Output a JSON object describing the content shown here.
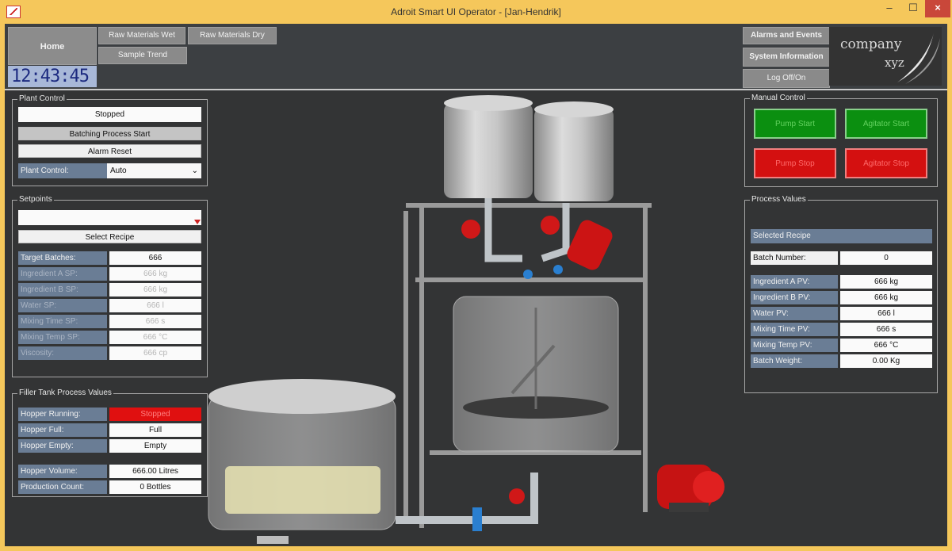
{
  "window": {
    "title": "Adroit Smart UI Operator - [Jan-Hendrik]",
    "minimize": "–",
    "maximize": "☐",
    "close": "×"
  },
  "nav": {
    "home": "Home",
    "raw_materials_wet": "Raw Materials Wet",
    "raw_materials_dry": "Raw Materials Dry",
    "sample_trend": "Sample Trend",
    "alarms_events": "Alarms and Events",
    "system_information": "System Information",
    "log_off": "Log Off/On",
    "clock": "12:43:45"
  },
  "logo": {
    "line1": "company",
    "line2": "xyz"
  },
  "plant_control": {
    "title": "Plant Control",
    "status": "Stopped",
    "batch_start": "Batching Process Start",
    "alarm_reset": "Alarm Reset",
    "mode_label": "Plant Control:",
    "mode_value": "Auto"
  },
  "setpoints": {
    "title": "Setpoints",
    "recipe_input": "",
    "select_recipe": "Select Recipe",
    "rows": [
      {
        "label": "Target Batches:",
        "value": "666"
      },
      {
        "label": "Ingredient A SP:",
        "value": "666 kg"
      },
      {
        "label": "Ingredient B SP:",
        "value": "666 kg"
      },
      {
        "label": "Water SP:",
        "value": "666 l"
      },
      {
        "label": "Mixing Time SP:",
        "value": "666 s"
      },
      {
        "label": "Mixing Temp SP:",
        "value": "666 °C"
      },
      {
        "label": "Viscosity:",
        "value": "666 cp"
      }
    ]
  },
  "filler": {
    "title": "Filler Tank Process Values",
    "rows": [
      {
        "label": "Hopper Running:",
        "value": "Stopped"
      },
      {
        "label": "Hopper Full:",
        "value": "Full"
      },
      {
        "label": "Hopper Empty:",
        "value": "Empty"
      },
      {
        "label": "Hopper Volume:",
        "value": "666.00 Litres"
      },
      {
        "label": "Production Count:",
        "value": "0 Bottles"
      }
    ]
  },
  "manual": {
    "title": "Manual Control",
    "pump_start": "Pump Start",
    "agitator_start": "Agitator Start",
    "pump_stop": "Pump Stop",
    "agitator_stop": "Agitator Stop"
  },
  "process": {
    "title": "Process Values",
    "selected_recipe": "Selected Recipe",
    "batch_label": "Batch Number:",
    "batch_value": "0",
    "rows": [
      {
        "label": "Ingredient A PV:",
        "value": "666 kg"
      },
      {
        "label": "Ingredient B PV:",
        "value": "666 kg"
      },
      {
        "label": "Water PV:",
        "value": "666 l"
      },
      {
        "label": "Mixing Time PV:",
        "value": "666 s"
      },
      {
        "label": "Mixing Temp PV:",
        "value": "666 °C"
      },
      {
        "label": "Batch Weight:",
        "value": "0.00 Kg"
      }
    ]
  },
  "colors": {
    "running_stopped": "#e01010",
    "green_button": "#0b8f10",
    "red_button": "#d41010",
    "label_bg": "#6a7d95",
    "title_bar": "#f5c75b"
  }
}
